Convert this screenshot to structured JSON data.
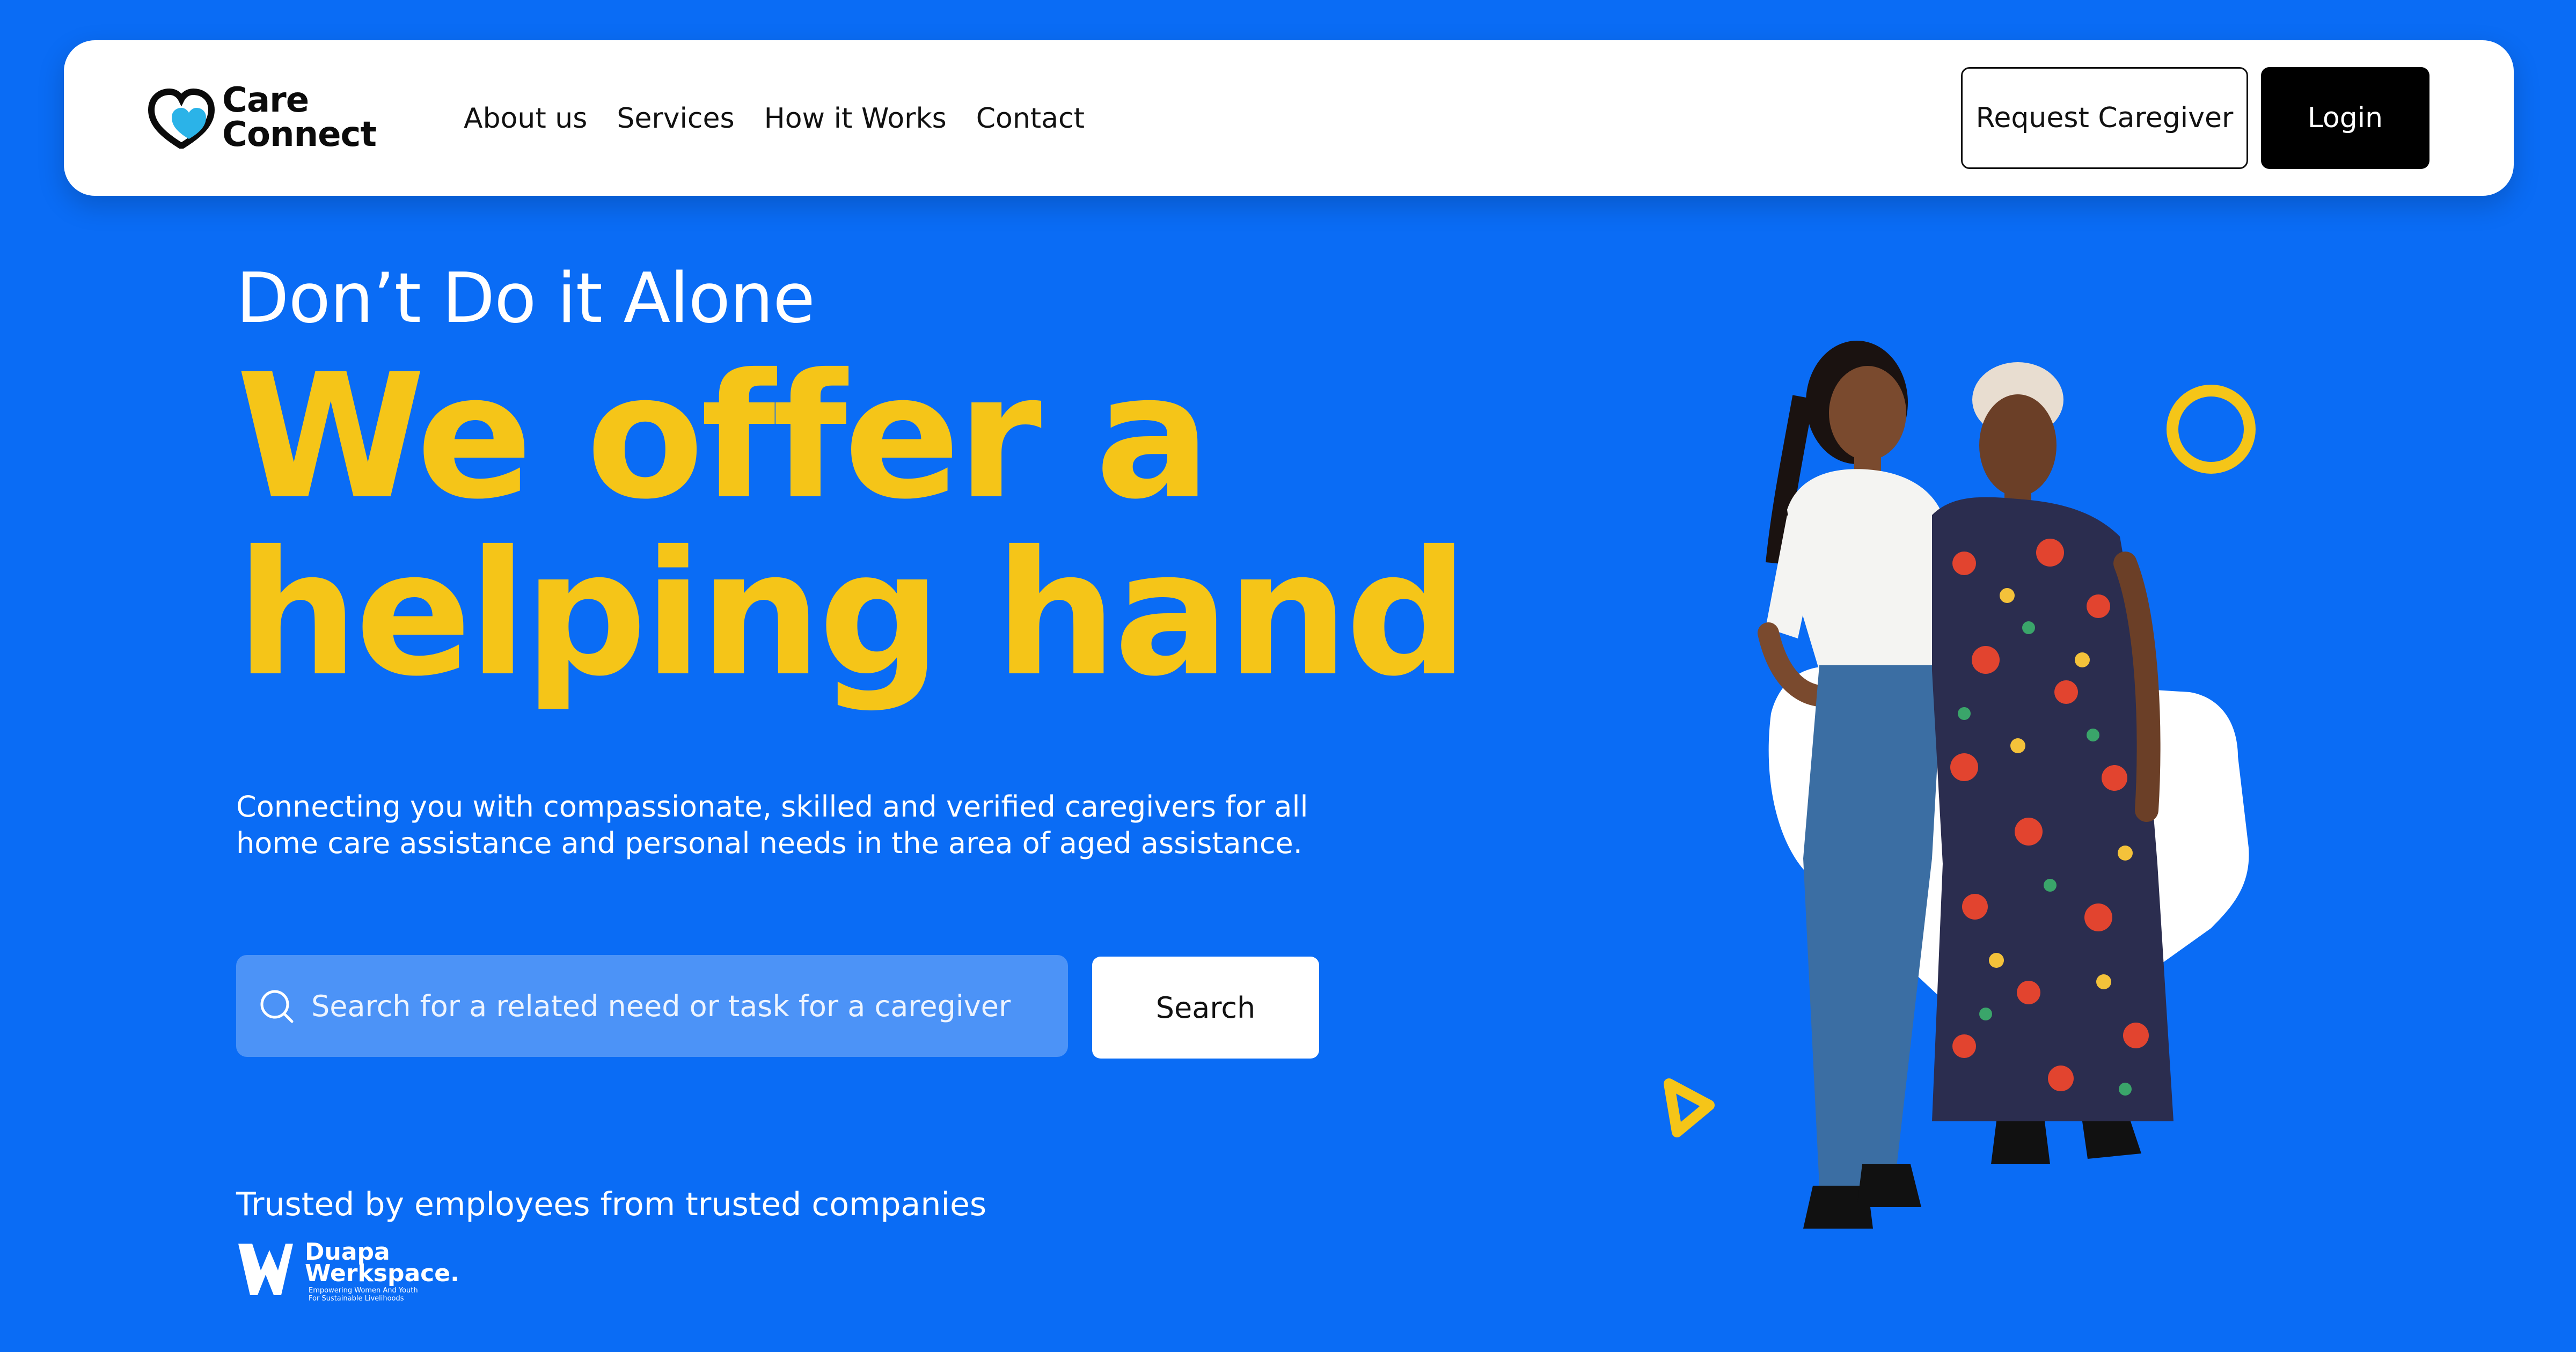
{
  "brand": {
    "line1": "Care",
    "line2": "Connect",
    "accent_color": "#2BB3E8"
  },
  "nav": {
    "links": [
      "About us",
      "Services",
      "How it Works",
      "Contact"
    ],
    "request_label": "Request Caregiver",
    "login_label": "Login"
  },
  "hero": {
    "eyebrow": "Don’t Do it Alone",
    "headline_line1": "We offer a",
    "headline_line2": "helping hand",
    "description": "Connecting you with compassionate, skilled and verified caregivers for all home care assistance and personal needs in the area of aged assistance."
  },
  "search": {
    "placeholder": "Search for a related need or task for a caregiver",
    "button_label": "Search"
  },
  "trust": {
    "text": "Trusted by employees from trusted companies",
    "partner_name_line1": "Duapa",
    "partner_name_line2": "Werkspace.",
    "partner_tagline_line1": "Empowering Women And Youth",
    "partner_tagline_line2": "For Sustainable Livelihoods"
  },
  "colors": {
    "background": "#0A6CF5",
    "headline": "#F5C518",
    "search_field": "#4C93F7",
    "decor_yellow": "#F5C518"
  },
  "icons": [
    "heart-logo-icon",
    "search-icon",
    "circle-decor",
    "triangle-decor",
    "partner-logo-icon"
  ]
}
